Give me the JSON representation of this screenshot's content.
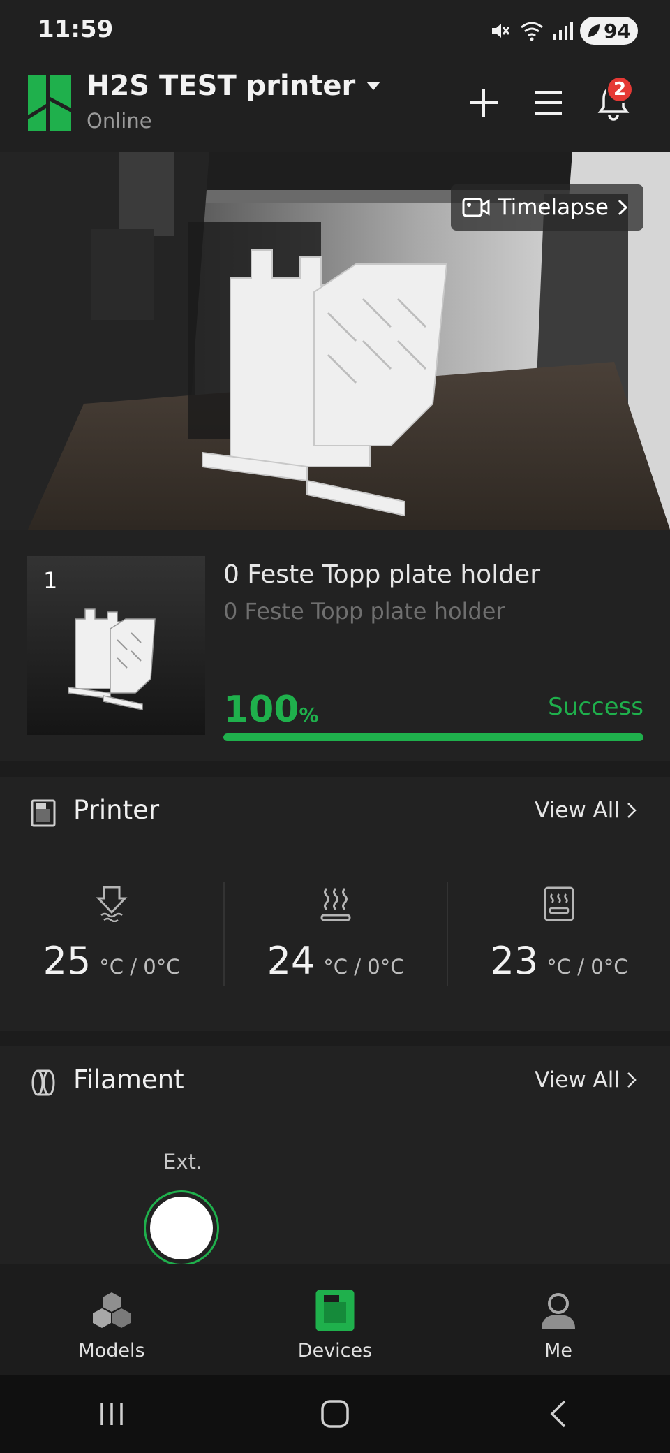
{
  "status_bar": {
    "time": "11:59",
    "battery": "94"
  },
  "header": {
    "printer_name": "H2S TEST printer",
    "status": "Online",
    "notification_count": "2"
  },
  "camera": {
    "timelapse_label": "Timelapse"
  },
  "job": {
    "plate_number": "1",
    "title": "0 Feste Topp plate holder",
    "subtitle": "0 Feste Topp plate holder",
    "progress_value": "100",
    "progress_unit": "%",
    "progress_fraction": 1.0,
    "result": "Success"
  },
  "printer_section": {
    "title": "Printer",
    "view_all": "View All",
    "temps": [
      {
        "icon": "nozzle-icon",
        "current": "25",
        "target": "°C / 0°C"
      },
      {
        "icon": "bed-heat-icon",
        "current": "24",
        "target": "°C / 0°C"
      },
      {
        "icon": "chamber-heat-icon",
        "current": "23",
        "target": "°C / 0°C"
      }
    ]
  },
  "filament_section": {
    "title": "Filament",
    "view_all": "View All",
    "ext_label": "Ext.",
    "spool_color": "#ffffff"
  },
  "bottom_nav": {
    "models": "Models",
    "devices": "Devices",
    "me": "Me"
  },
  "colors": {
    "accent": "#1fb04c",
    "badge": "#e53935",
    "background": "#1c1c1c",
    "card": "#222222"
  }
}
